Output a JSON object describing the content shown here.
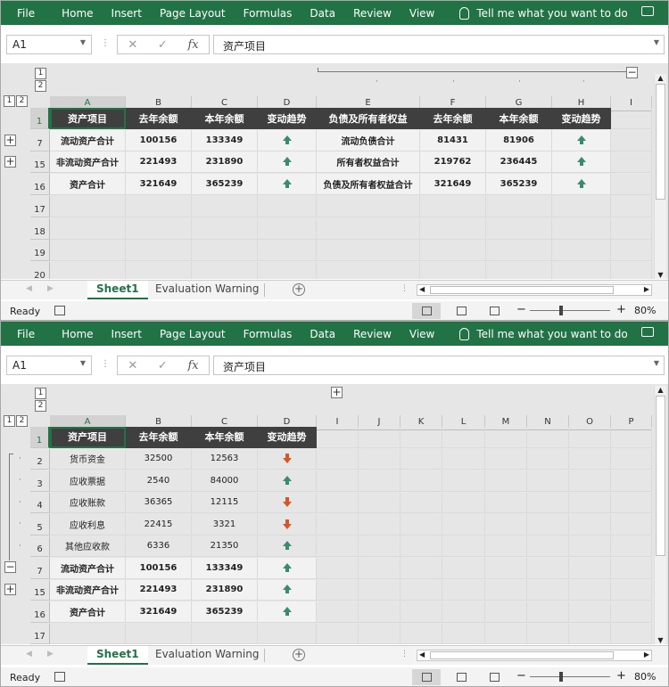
{
  "ribbon": {
    "tabs": [
      "File",
      "Home",
      "Insert",
      "Page Layout",
      "Formulas",
      "Data",
      "Review",
      "View"
    ],
    "tell_me": "Tell me what you want to do"
  },
  "formula_bar": {
    "name_box": "A1",
    "content": "资产项目"
  },
  "outline_levels": [
    "1",
    "2"
  ],
  "columns_top": [
    "A",
    "B",
    "C",
    "D",
    "E",
    "F",
    "G",
    "H",
    "I"
  ],
  "columns_bottom": [
    "A",
    "B",
    "C",
    "D",
    "I",
    "J",
    "K",
    "L",
    "M",
    "N",
    "O",
    "P"
  ],
  "headers": [
    "资产项目",
    "去年余额",
    "本年余额",
    "变动趋势",
    "负债及所有者权益",
    "去年余额",
    "本年余额",
    "变动趋势"
  ],
  "top_rows": [
    {
      "row": "7",
      "a": "流动资产合计",
      "b": "100156",
      "c": "133349",
      "d": "up",
      "e": "流动负债合计",
      "f": "81431",
      "g": "81906",
      "h": "up"
    },
    {
      "row": "15",
      "a": "非流动资产合计",
      "b": "221493",
      "c": "231890",
      "d": "up",
      "e": "所有者权益合计",
      "f": "219762",
      "g": "236445",
      "h": "up"
    },
    {
      "row": "16",
      "a": "资产合计",
      "b": "321649",
      "c": "365239",
      "d": "up",
      "e": "负债及所有者权益合计",
      "f": "321649",
      "g": "365239",
      "h": "up"
    }
  ],
  "top_empty_rows": [
    "17",
    "18",
    "19",
    "20"
  ],
  "bottom_rows": [
    {
      "row": "2",
      "a": "货币资金",
      "b": "32500",
      "c": "12563",
      "d": "down",
      "bold": false
    },
    {
      "row": "3",
      "a": "应收票据",
      "b": "2540",
      "c": "84000",
      "d": "up",
      "bold": false
    },
    {
      "row": "4",
      "a": "应收账款",
      "b": "36365",
      "c": "12115",
      "d": "down",
      "bold": false
    },
    {
      "row": "5",
      "a": "应收利息",
      "b": "22415",
      "c": "3321",
      "d": "down",
      "bold": false
    },
    {
      "row": "6",
      "a": "其他应收款",
      "b": "6336",
      "c": "21350",
      "d": "up",
      "bold": false
    },
    {
      "row": "7",
      "a": "流动资产合计",
      "b": "100156",
      "c": "133349",
      "d": "up",
      "bold": true
    },
    {
      "row": "15",
      "a": "非流动资产合计",
      "b": "221493",
      "c": "231890",
      "d": "up",
      "bold": true
    },
    {
      "row": "16",
      "a": "资产合计",
      "b": "321649",
      "c": "365239",
      "d": "up",
      "bold": true
    }
  ],
  "bottom_empty_rows": [
    "17"
  ],
  "sheet_tabs": [
    "Sheet1",
    "Evaluation Warning"
  ],
  "status": {
    "ready": "Ready",
    "zoom": "80%"
  },
  "colors": {
    "ribbon": "#217346",
    "header_fill": "#3f3f3f",
    "up_arrow": "#3b8a70",
    "down_arrow": "#d4572b"
  }
}
